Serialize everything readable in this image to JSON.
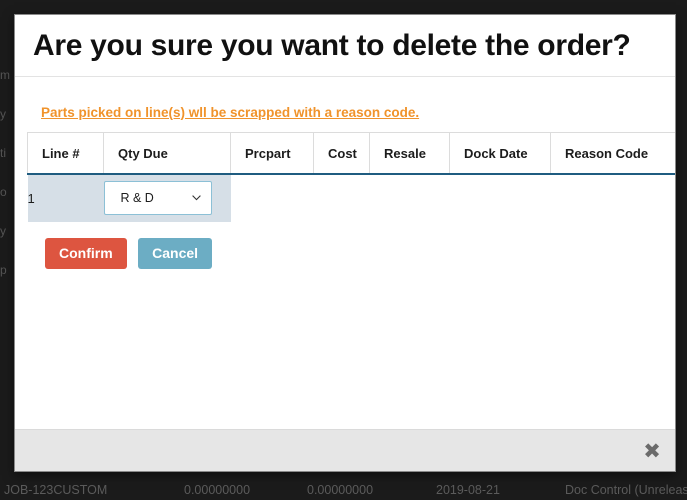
{
  "background": {
    "left_strip_fragments": [
      "m",
      "y",
      "ti",
      "o",
      "y",
      "p"
    ],
    "bottom_row": {
      "job": "JOB-123CUSTOM",
      "value_1": "0.00000000",
      "value_2": "0.00000000",
      "date": "2019-08-21",
      "status": "Doc Control (Unreleas"
    }
  },
  "modal": {
    "title": "Are you sure you want to delete the order?",
    "warning": "Parts picked on line(s) wll be scrapped with a reason code.",
    "table": {
      "headers": [
        "Line #",
        "Qty Due",
        "Prcpart",
        "Cost",
        "Resale",
        "Dock Date",
        "Reason Code"
      ],
      "rows": [
        {
          "line": "1",
          "reason_code_value": "R & D",
          "reason_code_options": [
            "R & D"
          ]
        }
      ]
    },
    "actions": {
      "confirm_label": "Confirm",
      "cancel_label": "Cancel"
    },
    "close_icon": "✖"
  },
  "colors": {
    "warning": "#f0932b",
    "confirm": "#dd5540",
    "cancel": "#6cadc4",
    "header_underline": "#1f5c80",
    "row_highlight": "#d6dfe7"
  }
}
